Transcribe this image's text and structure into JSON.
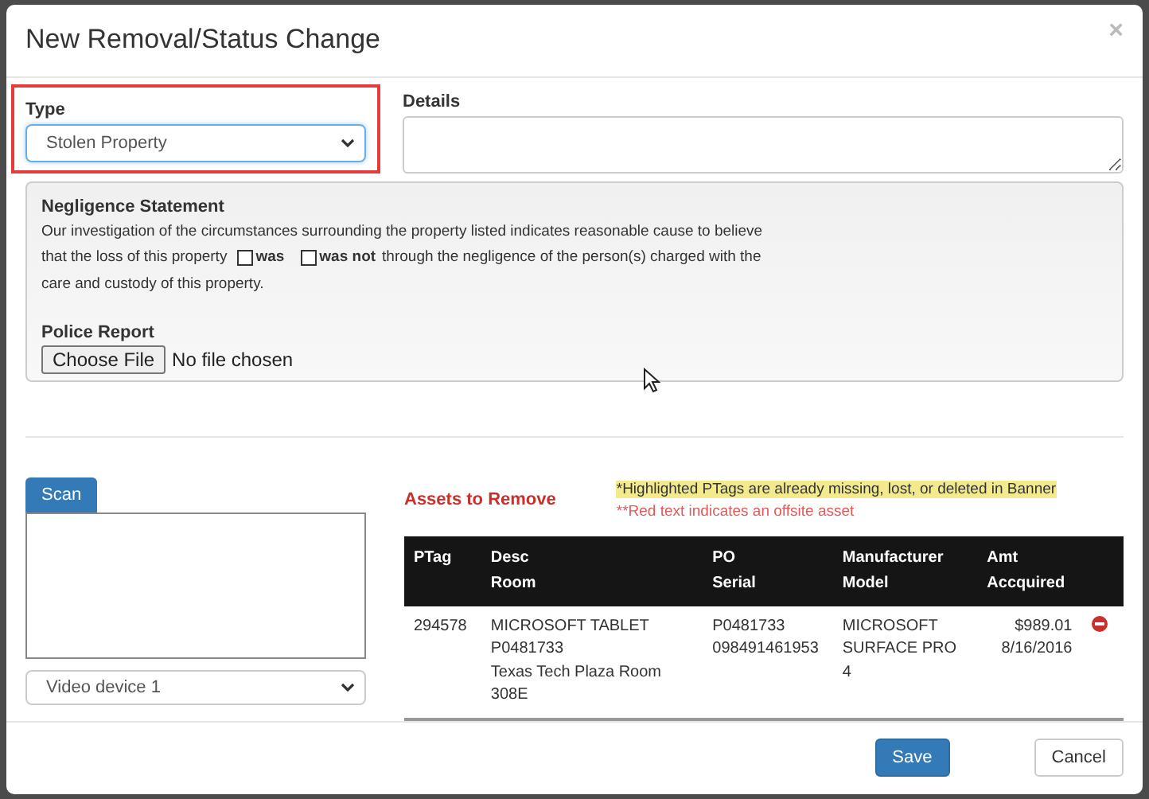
{
  "dialog": {
    "title": "New Removal/Status Change",
    "close": "×"
  },
  "type_field": {
    "label": "Type",
    "value": "Stolen Property",
    "highlighted": true
  },
  "details_field": {
    "label": "Details"
  },
  "negligence": {
    "title": "Negligence Statement",
    "line_1": "Our investigation of the circumstances surrounding the property listed indicates reasonable cause to believe",
    "line_2_before": "that the loss of this property",
    "options": [
      {
        "label": "was",
        "checked": false
      },
      {
        "label": "was not",
        "checked": false
      }
    ],
    "line_2_after": "through the negligence of the person(s) charged with the",
    "line_3": "care and custody of this property."
  },
  "police_report": {
    "label": "Police Report",
    "button": "Choose File",
    "status": "No file chosen"
  },
  "scanner": {
    "button": "Scan",
    "device": "Video device 1"
  },
  "assets": {
    "title": "Assets to Remove",
    "note_highlight": "*Highlighted PTags are already missing, lost, or deleted in Banner",
    "note_offsite": "**Red text indicates an offsite asset",
    "header_rows": [
      [
        {
          "text": "PTag",
          "rowspan": 2
        },
        {
          "text": "Desc"
        },
        {
          "text": "PO"
        },
        {
          "text": "Manufacturer"
        },
        {
          "text": "Amt"
        }
      ],
      [
        {
          "text": "Room"
        },
        {
          "text": "Serial"
        },
        {
          "text": "Model"
        },
        {
          "text": "Accquired"
        }
      ]
    ],
    "rows": [
      {
        "cells": [
          [
            "294578"
          ],
          [
            "MICROSOFT TABLET",
            "P0481733",
            "Texas Tech Plaza Room 308E"
          ],
          [
            "P0481733",
            "098491461953"
          ],
          [
            "MICROSOFT",
            "SURFACE PRO 4"
          ],
          [
            "$989.01",
            "8/16/2016"
          ]
        ],
        "removable": true
      }
    ]
  },
  "footer": {
    "buttons": [
      {
        "label": "Save",
        "kind": "primary"
      },
      {
        "label": "Cancel",
        "kind": "default"
      }
    ]
  }
}
